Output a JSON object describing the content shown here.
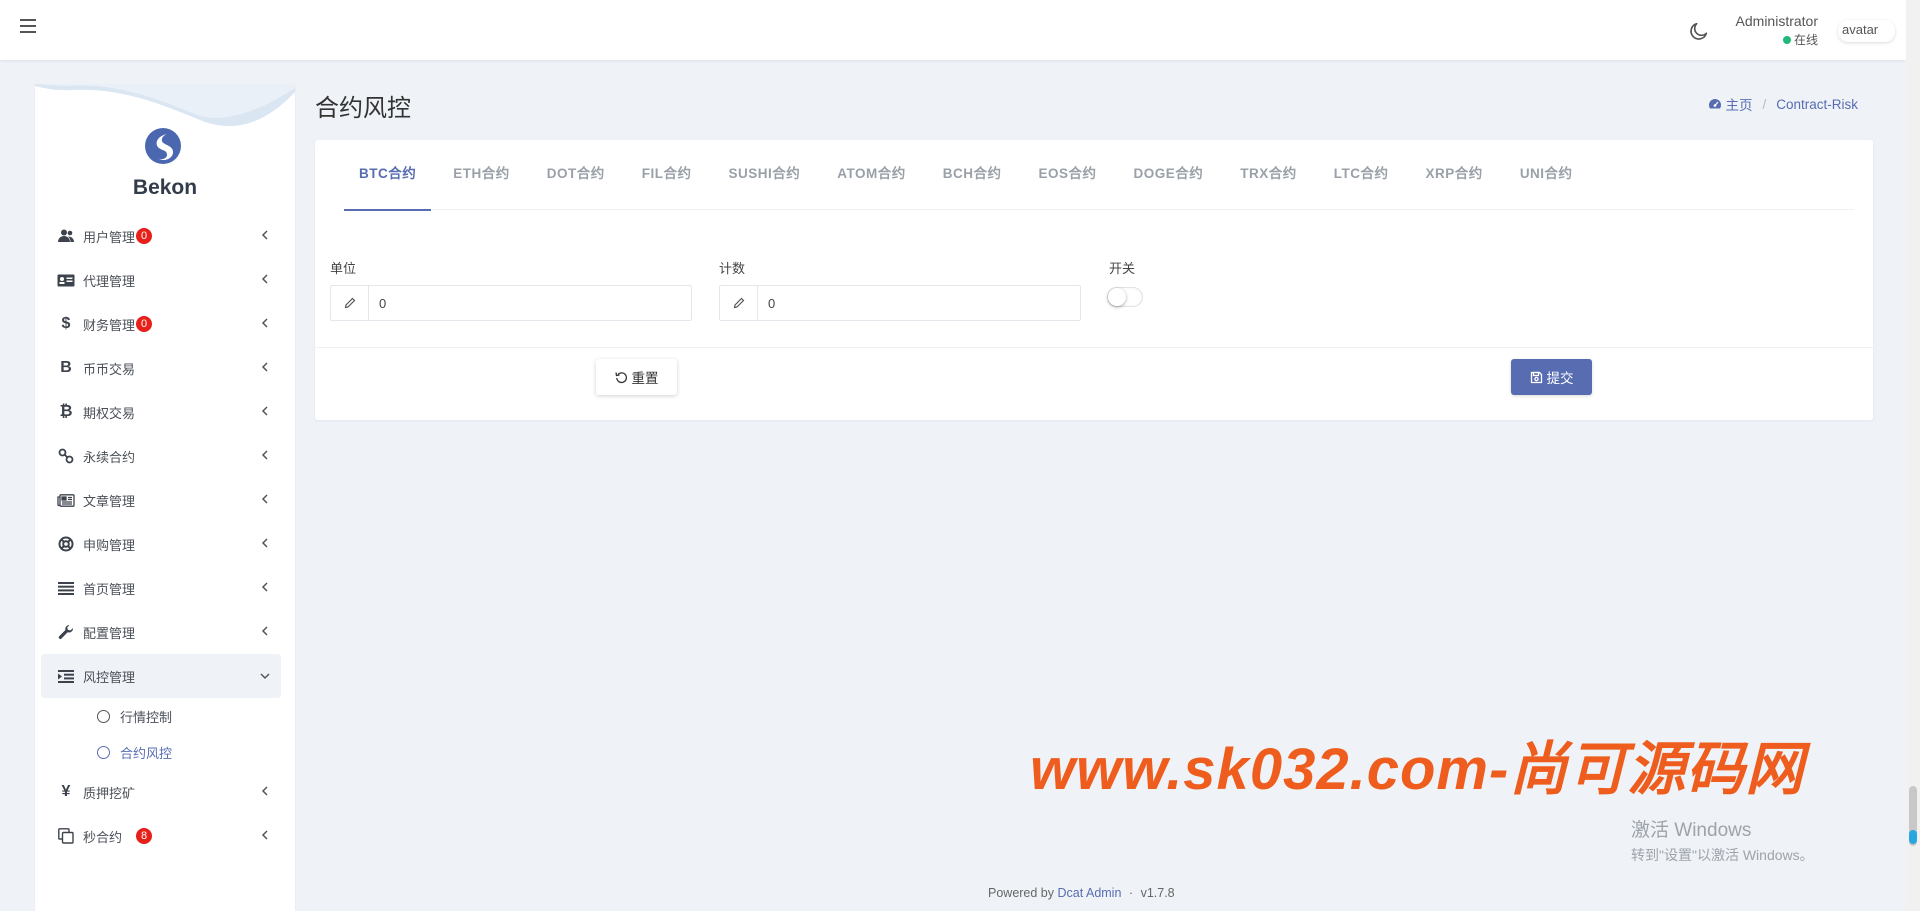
{
  "header": {
    "user_name": "Administrator",
    "user_status": "在线",
    "avatar_alt": "avatar"
  },
  "sidebar": {
    "brand": "Bekon",
    "items": [
      {
        "label": "用户管理",
        "icon": "user-group-icon",
        "badge": "0"
      },
      {
        "label": "代理管理",
        "icon": "id-card-icon"
      },
      {
        "label": "财务管理",
        "icon": "dollar-icon",
        "badge": "0"
      },
      {
        "label": "币币交易",
        "icon": "b-letter-icon"
      },
      {
        "label": "期权交易",
        "icon": "bitcoin-icon"
      },
      {
        "label": "永续合约",
        "icon": "link-icon"
      },
      {
        "label": "文章管理",
        "icon": "newspaper-icon"
      },
      {
        "label": "申购管理",
        "icon": "life-ring-icon"
      },
      {
        "label": "首页管理",
        "icon": "list-icon"
      },
      {
        "label": "配置管理",
        "icon": "wrench-icon"
      },
      {
        "label": "风控管理",
        "icon": "indent-icon",
        "open": true
      },
      {
        "label": "质押挖矿",
        "icon": "yen-icon"
      },
      {
        "label": "秒合约",
        "icon": "copy-icon",
        "badge": "8"
      }
    ],
    "risk_submenu": [
      {
        "label": "行情控制"
      },
      {
        "label": "合约风控",
        "active": true
      }
    ]
  },
  "page": {
    "title": "合约风控",
    "breadcrumb": {
      "home": "主页",
      "current": "Contract-Risk"
    }
  },
  "tabs": [
    "BTC合约",
    "ETH合约",
    "DOT合约",
    "FIL合约",
    "SUSHI合约",
    "ATOM合约",
    "BCH合约",
    "EOS合约",
    "DOGE合约",
    "TRX合约",
    "LTC合约",
    "XRP合约",
    "UNI合约"
  ],
  "active_tab": "BTC合约",
  "form": {
    "unit_label": "单位",
    "unit_value": "0",
    "count_label": "计数",
    "count_value": "0",
    "switch_label": "开关",
    "switch_on": false,
    "reset_label": "重置",
    "submit_label": "提交"
  },
  "watermark": "www.sk032.com-尚可源码网",
  "windows_notice": {
    "title": "激活 Windows",
    "subtitle": "转到\"设置\"以激活 Windows。"
  },
  "footer": {
    "powered_by": "Powered by",
    "link": "Dcat Admin",
    "separator": "·",
    "version": "v1.7.8"
  },
  "colors": {
    "primary": "#586cb1",
    "badge": "#e8201a",
    "online": "#21b978",
    "watermark": "#ee5d1d"
  }
}
